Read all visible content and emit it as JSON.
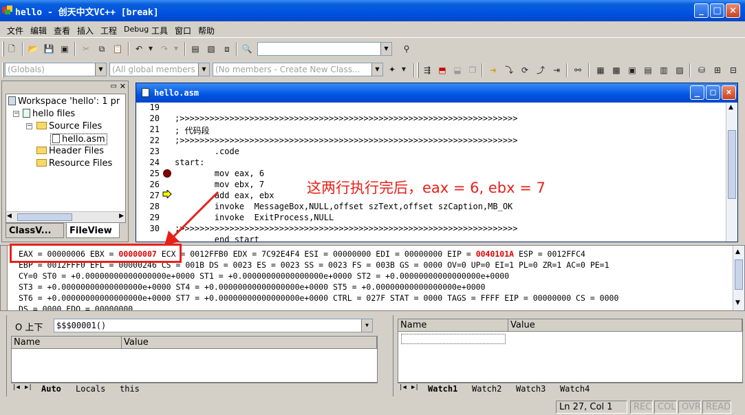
{
  "window": {
    "title": "hello - 创天中文VC++ [break]",
    "minimize": "_",
    "maximize": "□",
    "close": "×"
  },
  "menu": [
    "文件",
    "编辑",
    "查看",
    "插入",
    "工程",
    "Debug",
    "工具",
    "窗口",
    "帮助"
  ],
  "toolbar": {
    "find_value": "",
    "wizard": {
      "class_combo": "(Globals)",
      "members_combo": "(All global members",
      "filter_combo": "(No members - Create New Class..."
    }
  },
  "workspace": {
    "tree": [
      {
        "label": "Workspace 'hello': 1 pr"
      },
      {
        "label": "hello files"
      },
      {
        "label": "Source Files"
      },
      {
        "label": "hello.asm"
      },
      {
        "label": "Header Files"
      },
      {
        "label": "Resource Files"
      }
    ],
    "tabs": [
      "ClassV...",
      "FileView"
    ]
  },
  "editor": {
    "title": "hello.asm",
    "lines": [
      {
        "n": "19",
        "text": ""
      },
      {
        "n": "20",
        "text": ";>>>>>>>>>>>>>>>>>>>>>>>>>>>>>>>>>>>>>>>>>>>>>>>>>>>>>>>>>>>>>>>>>>>>"
      },
      {
        "n": "21",
        "text": "; 代码段"
      },
      {
        "n": "22",
        "text": ";>>>>>>>>>>>>>>>>>>>>>>>>>>>>>>>>>>>>>>>>>>>>>>>>>>>>>>>>>>>>>>>>>>>>"
      },
      {
        "n": "23",
        "text": "        .code"
      },
      {
        "n": "24",
        "text": "start:"
      },
      {
        "n": "25",
        "text": "        mov eax, 6"
      },
      {
        "n": "26",
        "text": "        mov ebx, 7"
      },
      {
        "n": "27",
        "text": "        add eax, ebx"
      },
      {
        "n": "28",
        "text": "        invoke  MessageBox,NULL,offset szText,offset szCaption,MB_OK"
      },
      {
        "n": "29",
        "text": "        invoke  ExitProcess,NULL"
      },
      {
        "n": "30",
        "text": ";>>>>>>>>>>>>>>>>>>>>>>>>>>>>>>>>>>>>>>>>>>>>>>>>>>>>>>>>>>>>>>>>>>>>"
      },
      {
        "n": "",
        "text": "        end start"
      }
    ],
    "annotation": "这两行执行完后，eax = 6, ebx = 7"
  },
  "registers": {
    "line1": {
      "a": "EAX = 00000006 EBX = ",
      "ebx": "00000007",
      "b": " ECX = 0012FFB0 EDX = 7C92E4F4 ESI = 00000000 EDI = 00000000 EIP = ",
      "eip": "0040101A",
      "c": " ESP = 0012FFC4"
    },
    "line2": "EBP = 0012FFF0 EFL = 00000246 CS = 001B DS = 0023 ES = 0023 SS = 0023 FS = 003B GS = 0000 OV=0 UP=0 EI=1 PL=0 ZR=1 AC=0 PE=1",
    "line3": "CY=0 ST0 = +0.00000000000000000e+0000 ST1 = +0.00000000000000000e+0000 ST2 = +0.00000000000000000e+0000",
    "line4": "ST3 = +0.00000000000000000e+0000 ST4 = +0.00000000000000000e+0000 ST5 = +0.00000000000000000e+0000",
    "line5": "ST6 = +0.00000000000000000e+0000 ST7 = +0.00000000000000000e+0000 CTRL = 027F STAT = 0000 TAGS = FFFF EIP = 00000000 CS = 0000",
    "line6": "DS = 0000 EDO = 00000000"
  },
  "variables": {
    "context_label": "O 上下",
    "context_value": "$$$00001()",
    "col_name": "Name",
    "col_value": "Value",
    "tabs": [
      "Auto",
      "Locals",
      "this"
    ]
  },
  "watch": {
    "col_name": "Name",
    "col_value": "Value",
    "tabs": [
      "Watch1",
      "Watch2",
      "Watch3",
      "Watch4"
    ]
  },
  "status": {
    "position": "Ln 27, Col 1",
    "rec": "REC",
    "col": "COL",
    "ovr": "OVR",
    "read": "READ"
  },
  "colors": {
    "title_blue": "#0054e3",
    "highlight_red": "#e00000",
    "annotation_red": "#e8201a"
  }
}
